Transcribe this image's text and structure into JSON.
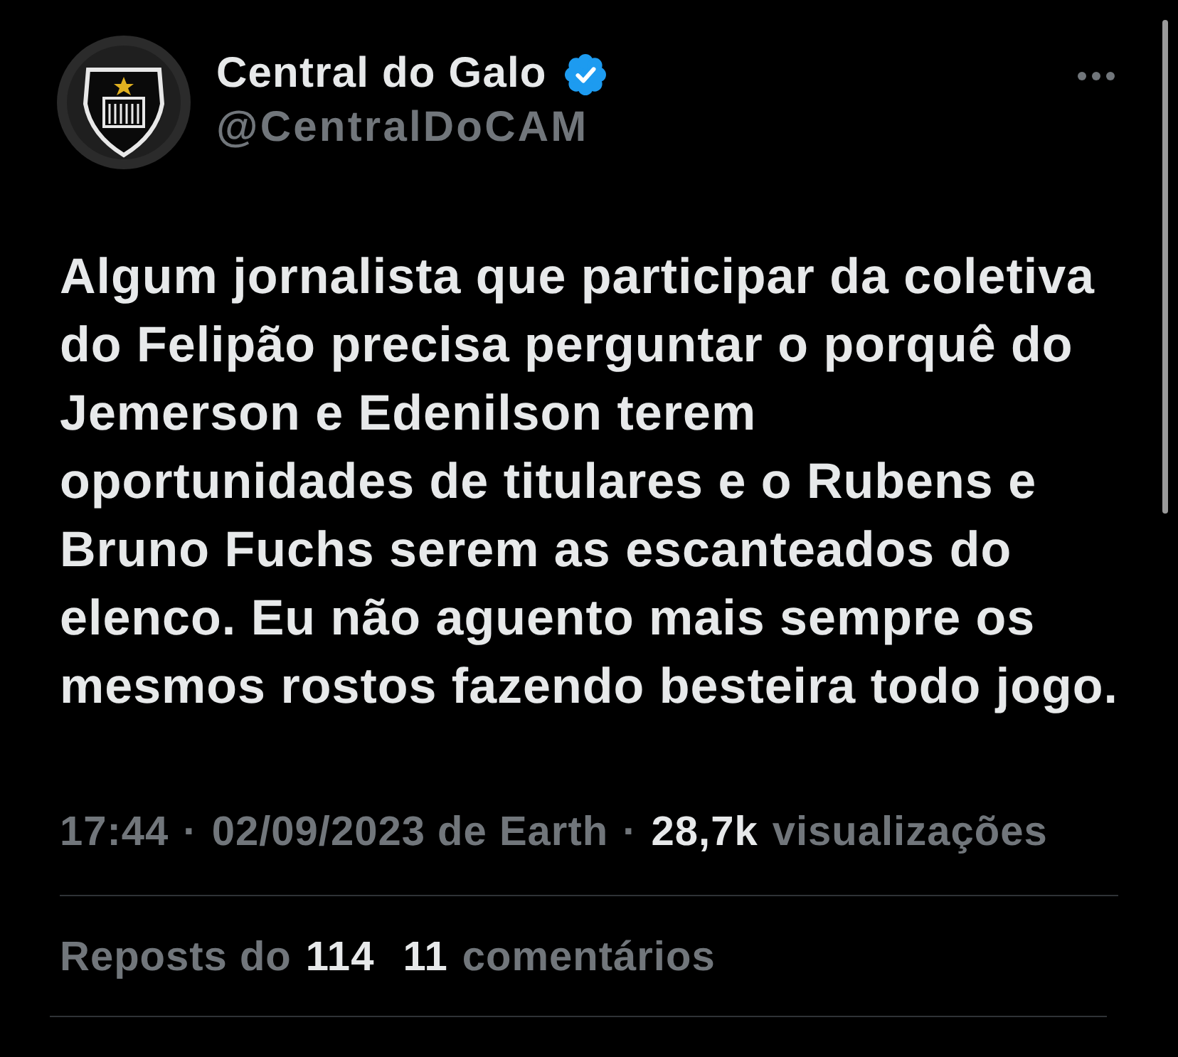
{
  "author": {
    "name": "Central do Galo",
    "verified": true,
    "handle": "@CentralDoCAM"
  },
  "post": {
    "text": "Algum jornalista que participar da coletiva\ndo Felipão precisa perguntar o porquê do\nJemerson e Edenilson terem\noportunidades de titulares e o Rubens e\nBruno Fuchs serem as escanteados do\nelenco. Eu não aguento mais sempre os\nmesmos rostos fazendo besteira todo jogo."
  },
  "meta": {
    "time": "17:44",
    "separator_1": "·",
    "date": "02/09/2023 de Earth",
    "separator_2": "·",
    "views_count": "28,7k",
    "views_label": "visualizações"
  },
  "engagement": [
    {
      "kind": "reposts",
      "label": "Reposts do",
      "count": "114"
    },
    {
      "kind": "comments",
      "count": "11",
      "label": "comentários"
    }
  ]
}
